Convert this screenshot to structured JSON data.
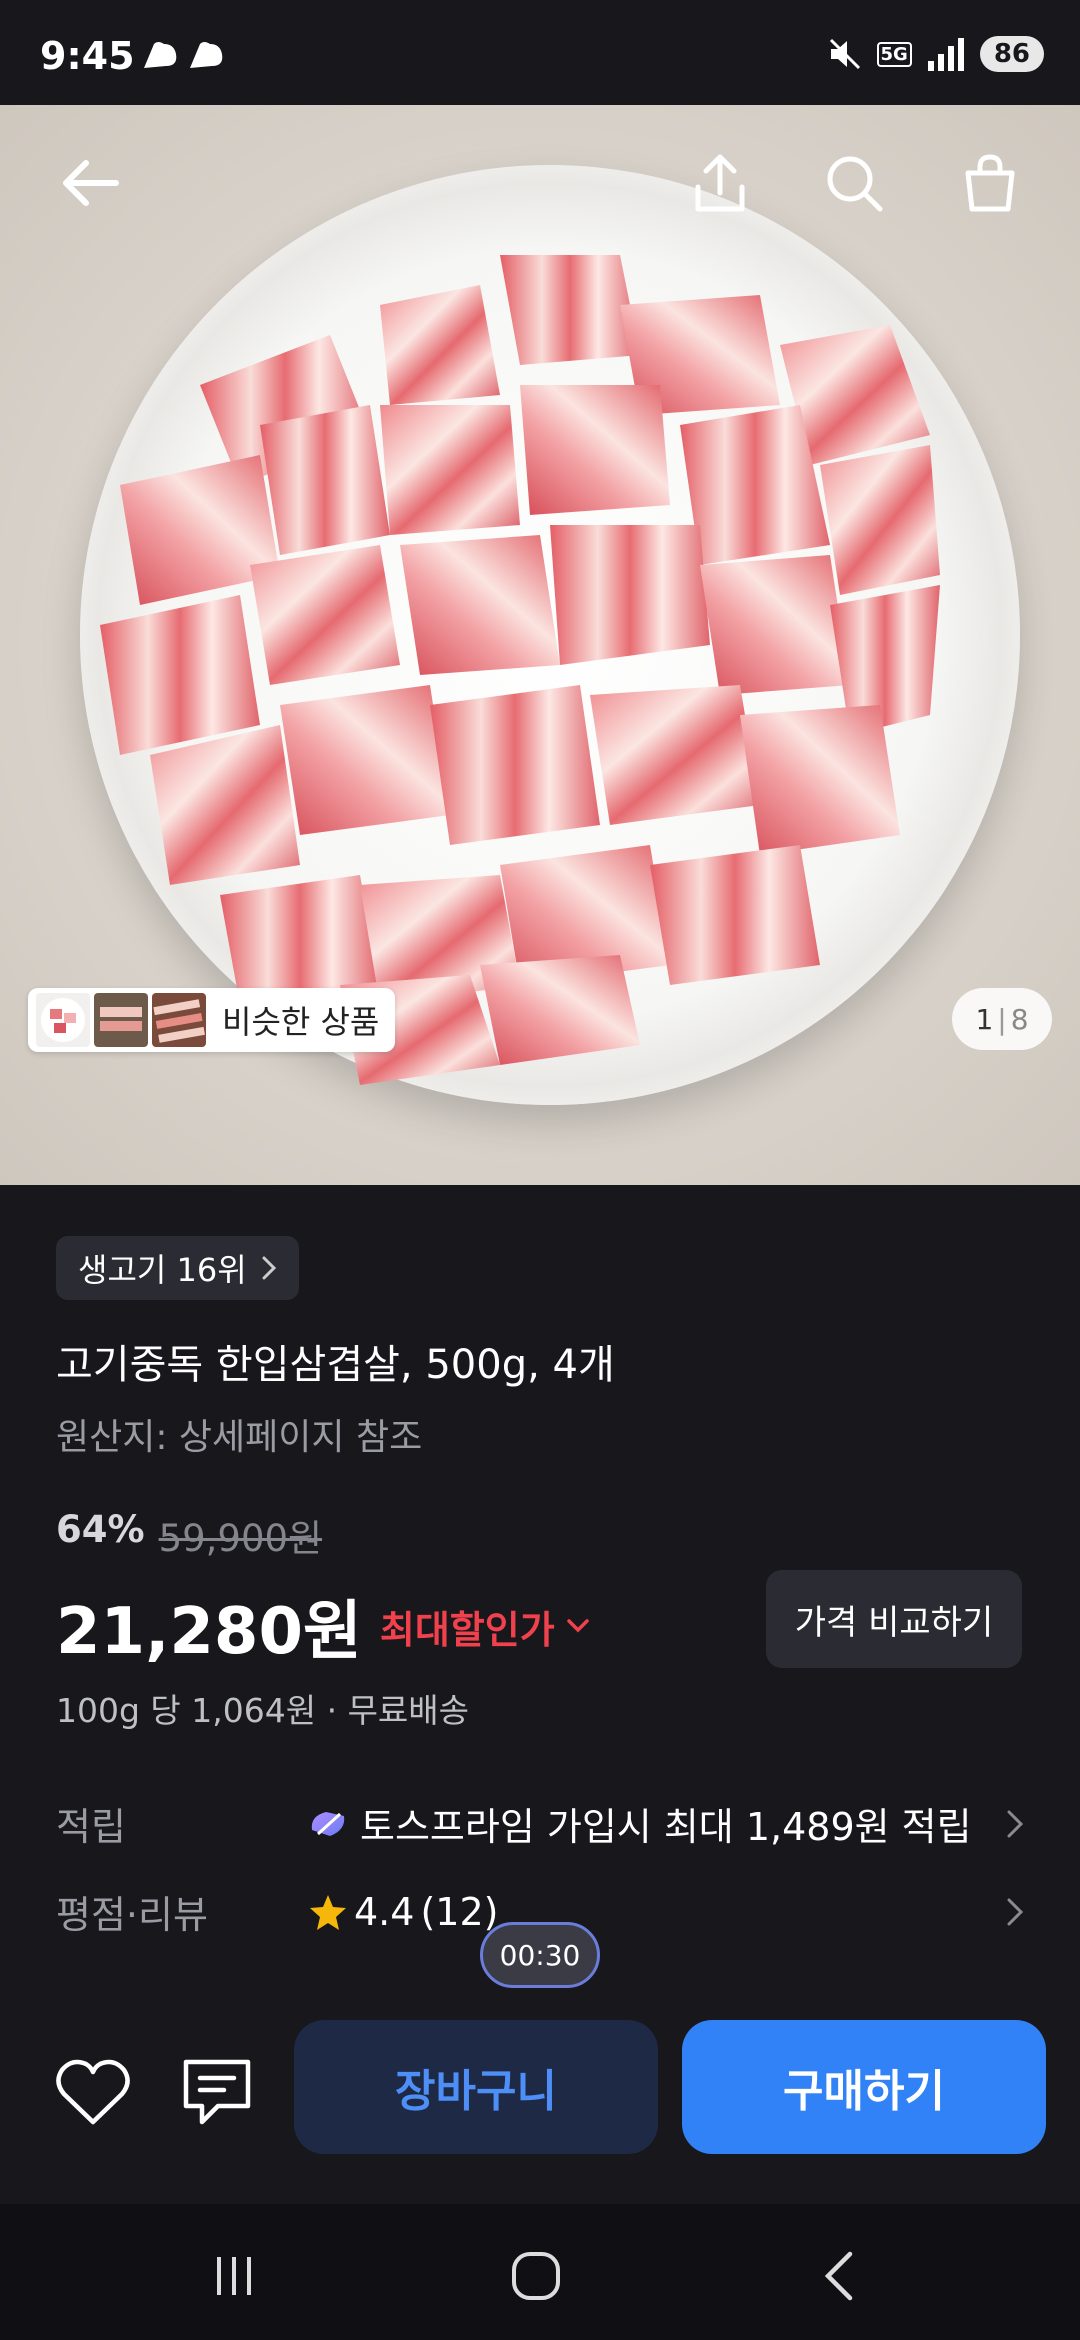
{
  "status": {
    "time": "9:45",
    "battery": "86",
    "network": "5G"
  },
  "nav": {
    "back_icon": "arrow-left-icon",
    "share_icon": "share-icon",
    "search_icon": "search-icon",
    "cart_icon": "shopping-bag-icon"
  },
  "gallery": {
    "similar_label": "비슷한 상품",
    "page_current": "1",
    "page_separator": "|",
    "page_total": "8"
  },
  "product": {
    "rank": "생고기 16위",
    "title": "고기중독 한입삼겹살, 500g, 4개",
    "origin": "원산지: 상세페이지 참조",
    "discount_rate": "64%",
    "original_price": "59,900원",
    "price": "21,280원",
    "max_deal_label": "최대할인가",
    "compare_label": "가격 비교하기",
    "unit_price": "100g 당 1,064원 · 무료배송"
  },
  "info": {
    "points_key": "적립",
    "points_value": "토스프라임 가입시 최대 1,489원 적립",
    "rating_key": "평점·리뷰",
    "rating_value": "4.4",
    "review_count": "(12)"
  },
  "timer": "00:30",
  "actions": {
    "cart_label": "장바구니",
    "buy_label": "구매하기"
  },
  "colors": {
    "background": "#17171c",
    "primary": "#3182f6",
    "sale_red": "#f0414c",
    "star": "#f5b70a"
  }
}
